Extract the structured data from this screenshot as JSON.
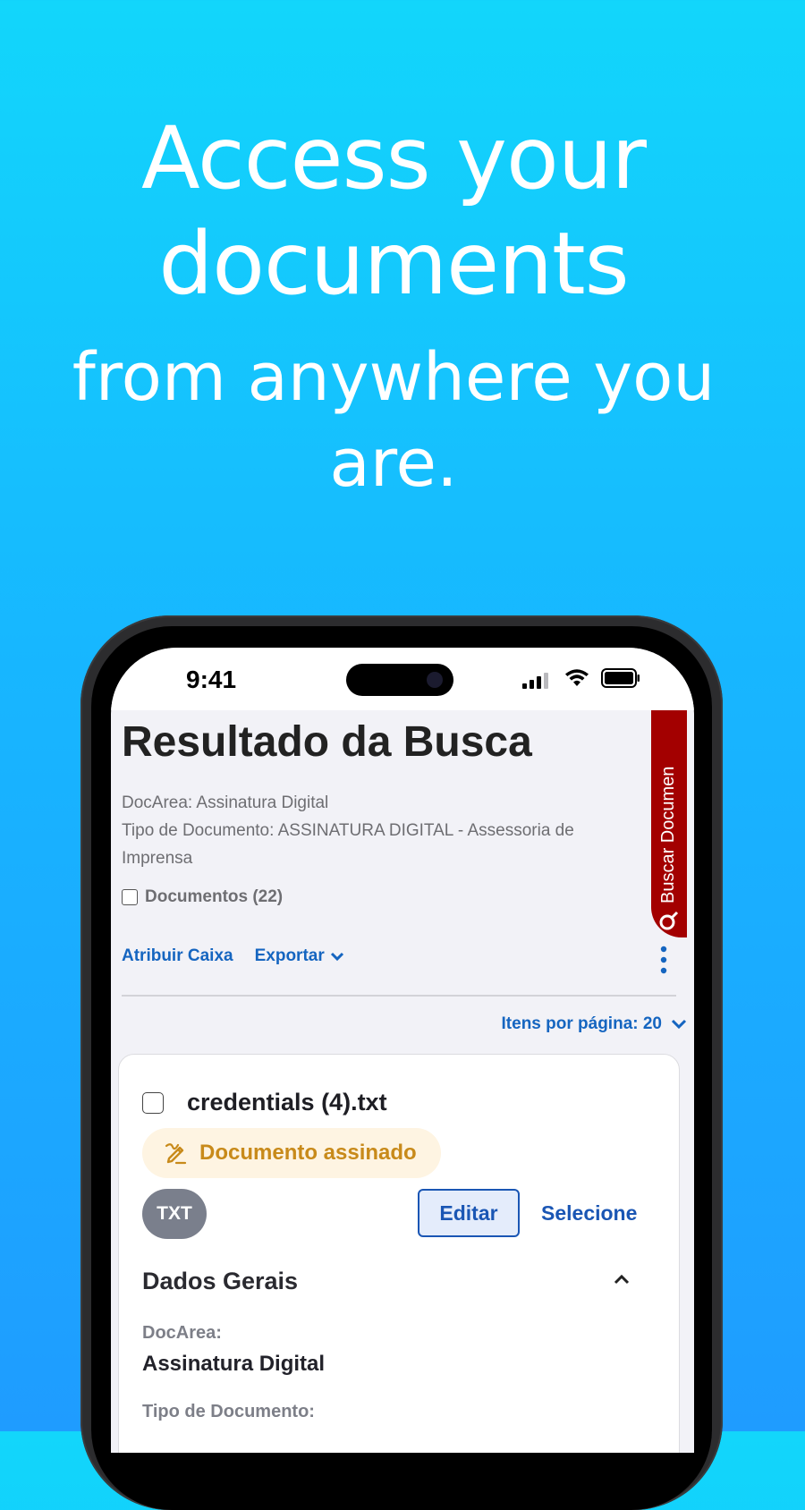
{
  "headline": {
    "line1": "Access your",
    "line2": "documents",
    "line3": "from anywhere you",
    "line4": "are."
  },
  "status_bar": {
    "time": "9:41",
    "icons": [
      "cellular-signal-icon",
      "wifi-icon",
      "battery-icon"
    ]
  },
  "page": {
    "title": "Resultado da Busca",
    "meta": {
      "docarea": "DocArea: Assinatura Digital",
      "doc_type": "Tipo de Documento: ASSINATURA DIGITAL - Assessoria de Imprensa"
    },
    "documents_label": "Documentos (22)",
    "actions": {
      "assign_box": "Atribuir Caixa",
      "export": "Exportar"
    },
    "items_per_page": "Itens por página: 20",
    "side_tab": "Buscar Documen"
  },
  "card": {
    "title": "credentials (4).txt",
    "signed_badge": "Documento assinado",
    "type_badge": "TXT",
    "edit_label": "Editar",
    "select_label": "Selecione",
    "section_title": "Dados Gerais",
    "fields": [
      {
        "label": "DocArea:",
        "value": "Assinatura Digital"
      },
      {
        "label": "Tipo de Documento:",
        "value": ""
      }
    ]
  },
  "colors": {
    "background_top": "#12d6fb",
    "background_bottom": "#1f9cff",
    "link_blue": "#1565c0",
    "side_tab_red": "#a30000",
    "signed_badge_text": "#c88a1a",
    "signed_badge_bg": "#fef4e2"
  }
}
